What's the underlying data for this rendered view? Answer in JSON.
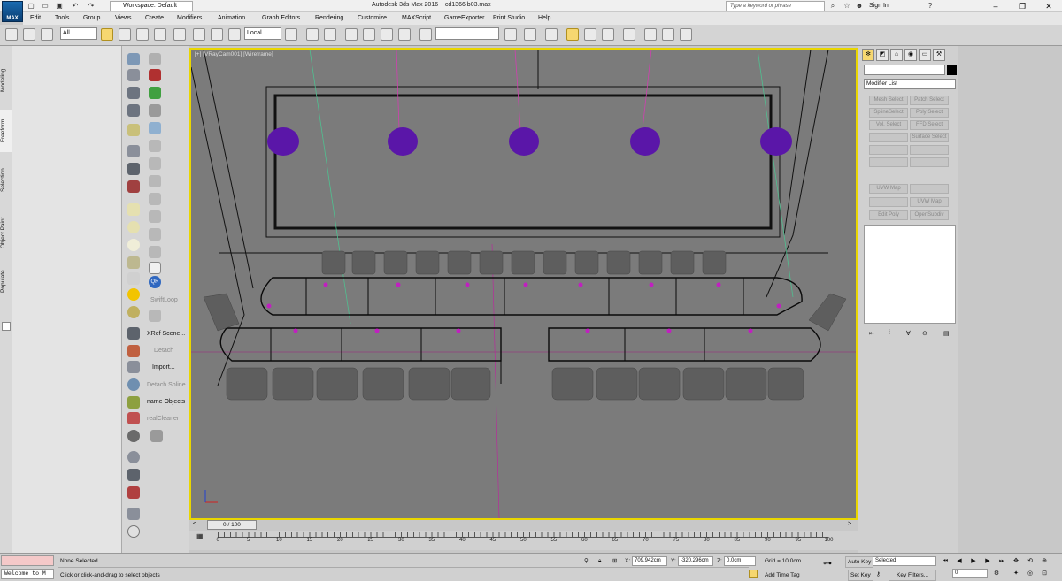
{
  "app": {
    "logo": "MAX",
    "title": "Autodesk 3ds Max 2016",
    "file": "cd1366 b03.max",
    "workspace": "Workspace: Default",
    "search_placeholder": "Type a keyword or phrase",
    "sign_in": "Sign In"
  },
  "menu": [
    "Edit",
    "Tools",
    "Group",
    "Views",
    "Create",
    "Modifiers",
    "Animation",
    "Graph Editors",
    "Rendering",
    "Customize",
    "MAXScript",
    "GameExporter",
    "Print Studio",
    "Help"
  ],
  "toolbar": {
    "filter_value": "All",
    "coord_system": "Local",
    "named_selection": ""
  },
  "left_tabs": [
    "Modeling",
    "Freeform",
    "Selection",
    "Object Paint",
    "Populate"
  ],
  "ribbon": {
    "swiftloop": "SwiftLoop",
    "xref_scene": "XRef Scene...",
    "detach": "Detach",
    "import": "Import...",
    "detach_spline": "Detach Spline",
    "rename_objects": "name Objects",
    "real_cleaner": "realCleaner",
    "qr_label": "QR"
  },
  "viewport": {
    "label": "[+] [VRayCam001] [Wireframe]",
    "colors": {
      "border": "#e9d600",
      "lamp": "#5a16a8",
      "wire": "#0a0a0a"
    }
  },
  "command_panel": {
    "modifier_list": "Modifier List",
    "buttons": [
      [
        "Mesh Select",
        "Patch Select"
      ],
      [
        "SplineSelect",
        "Poly Select"
      ],
      [
        "Vol. Select",
        "FFD Select"
      ],
      [
        "",
        "Surface Select"
      ],
      [
        "",
        ""
      ],
      [
        "",
        ""
      ],
      [
        "UVW Map",
        ""
      ],
      [
        "",
        "UVW Map"
      ],
      [
        "Edit Poly",
        "OpenSubdiv"
      ]
    ]
  },
  "timeline": {
    "frame": "0 / 100",
    "ticks": [
      "0",
      "5",
      "10",
      "15",
      "20",
      "25",
      "30",
      "35",
      "40",
      "45",
      "50",
      "55",
      "60",
      "65",
      "70",
      "75",
      "80",
      "85",
      "90",
      "95",
      "100"
    ]
  },
  "status": {
    "listener": "Welcome to M",
    "selection": "None Selected",
    "prompt": "Click or click-and-drag to select objects",
    "x_label": "X:",
    "x_value": "709.942cm",
    "y_label": "Y:",
    "y_value": "-320.296cm",
    "z_label": "Z:",
    "z_value": "0.0cm",
    "grid": "Grid = 10.0cm",
    "add_time_tag": "Add Time Tag",
    "auto_key": "Auto Key",
    "set_key": "Set Key",
    "key_mode": "Selected",
    "key_filters": "Key Filters...",
    "frame_field": "0"
  }
}
